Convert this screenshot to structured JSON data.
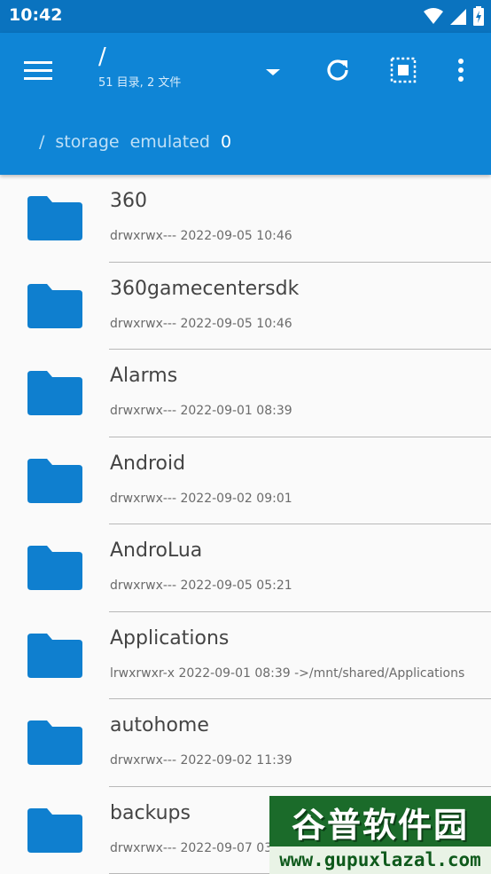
{
  "status_bar": {
    "time": "10:42"
  },
  "app_bar": {
    "title": "/",
    "subtitle": "51 目录, 2 文件",
    "breadcrumb": [
      {
        "label": "/"
      },
      {
        "label": "storage"
      },
      {
        "label": "emulated"
      },
      {
        "label": "0"
      }
    ]
  },
  "colors": {
    "status_bar": "#0a73bf",
    "app_bar": "#0f85d6",
    "folder": "#0f7fcf",
    "background": "#fafafa"
  },
  "files": [
    {
      "name": "360",
      "meta": "drwxrwx--- 2022-09-05 10:46",
      "icon": "folder-icon"
    },
    {
      "name": "360gamecentersdk",
      "meta": "drwxrwx--- 2022-09-05 10:46",
      "icon": "folder-icon"
    },
    {
      "name": "Alarms",
      "meta": "drwxrwx--- 2022-09-01 08:39",
      "icon": "folder-icon"
    },
    {
      "name": "Android",
      "meta": "drwxrwx--- 2022-09-02 09:01",
      "icon": "folder-icon"
    },
    {
      "name": "AndroLua",
      "meta": "drwxrwx--- 2022-09-05 05:21",
      "icon": "folder-icon"
    },
    {
      "name": "Applications",
      "meta": "lrwxrwxr-x 2022-09-01 08:39  ->/mnt/shared/Applications",
      "icon": "folder-icon"
    },
    {
      "name": "autohome",
      "meta": "drwxrwx--- 2022-09-02 11:39",
      "icon": "folder-icon"
    },
    {
      "name": "backups",
      "meta": "drwxrwx--- 2022-09-07 03:06",
      "icon": "folder-icon"
    }
  ],
  "watermark": {
    "line1": "谷普软件园",
    "line2": "www.gupuxlazal.com"
  }
}
